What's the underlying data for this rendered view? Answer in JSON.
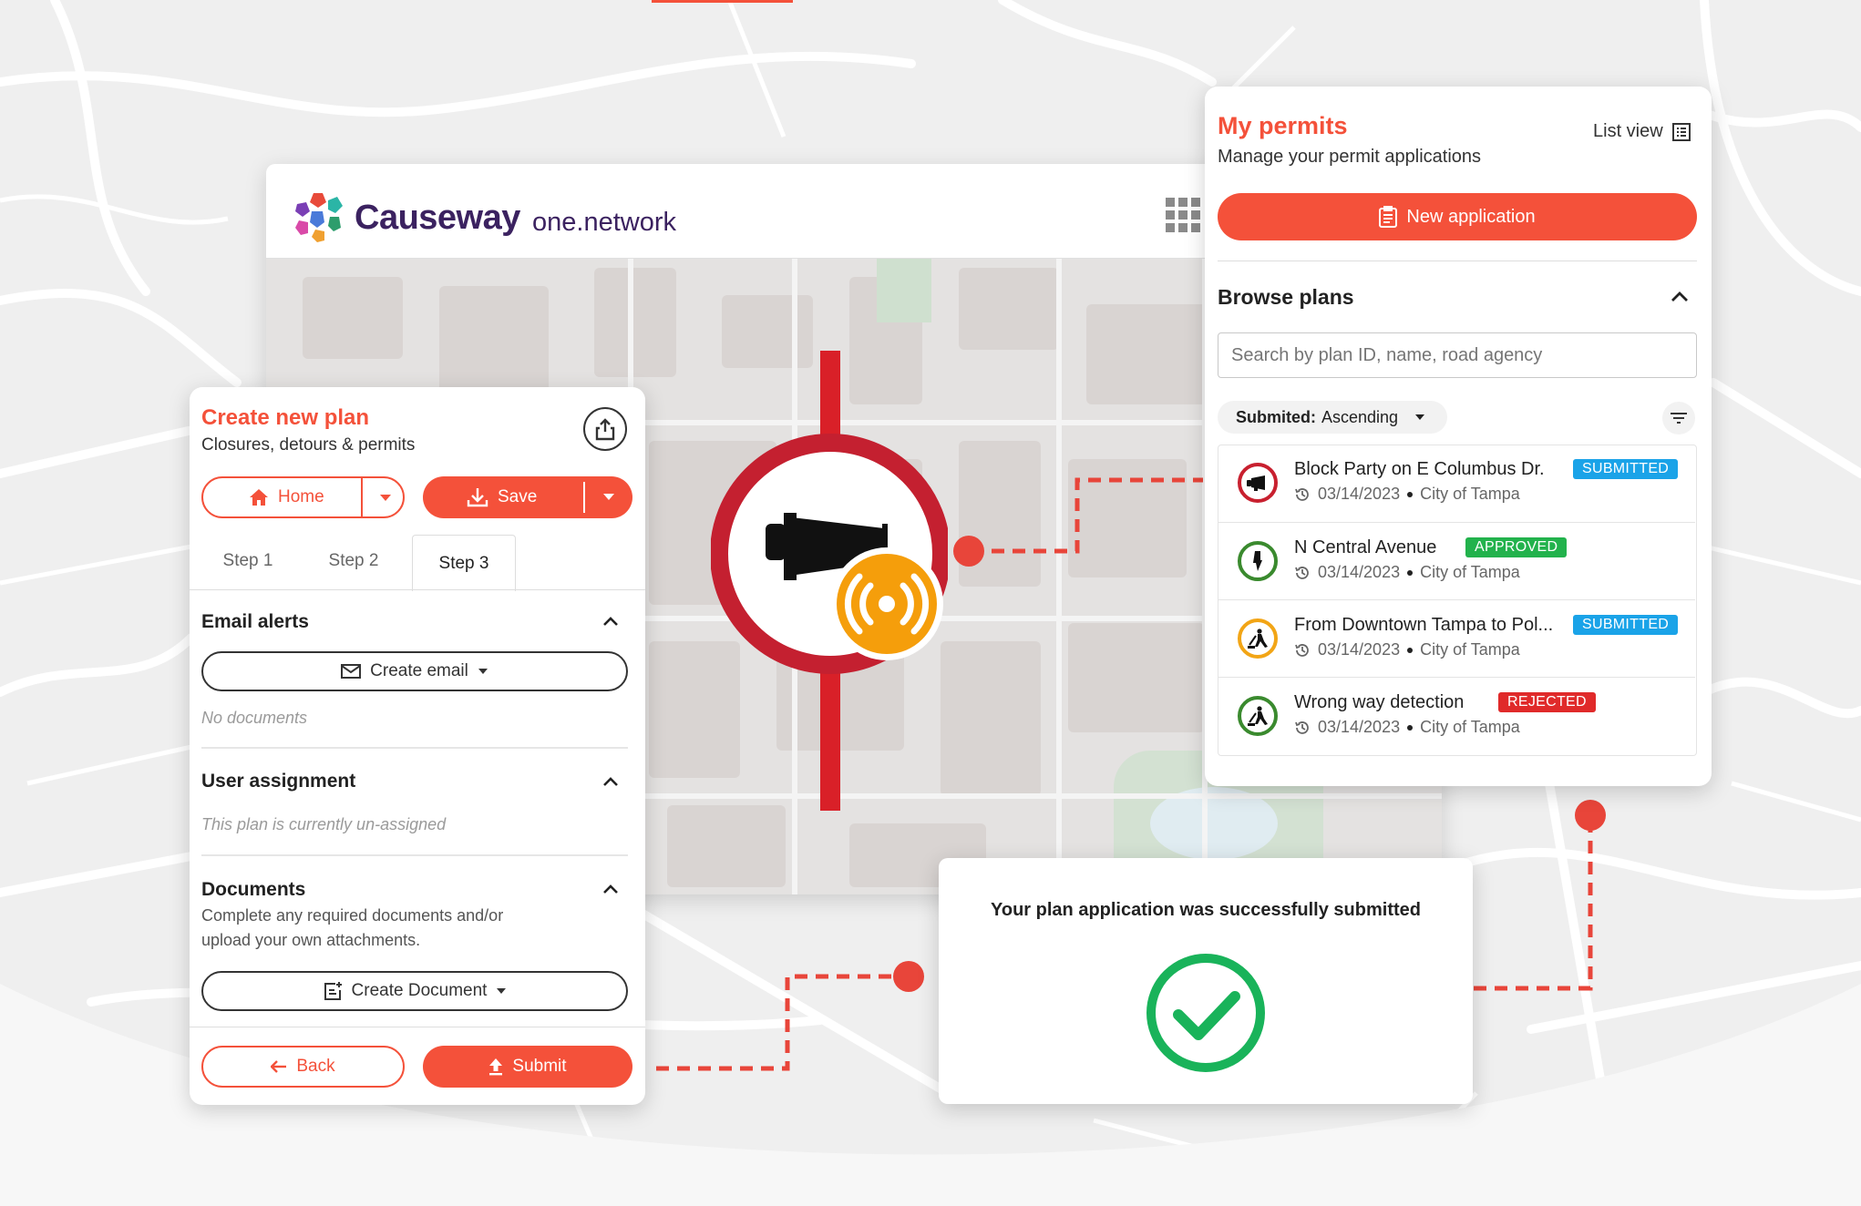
{
  "brand": {
    "name": "Causeway",
    "suffix": "one.network"
  },
  "create_plan": {
    "title": "Create new plan",
    "subtitle": "Closures, detours & permits",
    "home_label": "Home",
    "save_label": "Save",
    "steps": [
      "Step 1",
      "Step 2",
      "Step 3"
    ],
    "active_step": "Step 3",
    "email_alerts": {
      "title": "Email alerts",
      "button": "Create email",
      "empty": "No documents"
    },
    "user_assignment": {
      "title": "User assignment",
      "empty": "This plan is currently un-assigned"
    },
    "documents": {
      "title": "Documents",
      "description_line1": "Complete any required documents and/or",
      "description_line2": "upload your own attachments.",
      "button": "Create Document"
    },
    "back_label": "Back",
    "submit_label": "Submit"
  },
  "permits": {
    "title": "My permits",
    "subtitle": "Manage your permit applications",
    "list_view": "List view",
    "new_application": "New application",
    "browse_title": "Browse plans",
    "search_placeholder": "Search by plan ID, name, road agency",
    "sort_label": "Submited:",
    "sort_value": "Ascending",
    "items": [
      {
        "title": "Block Party on E Columbus Dr.",
        "status": "SUBMITTED",
        "date": "03/14/2023",
        "agency": "City of Tampa",
        "icon": "megaphone-icon",
        "ring": "#c8202f"
      },
      {
        "title": "N Central Avenue",
        "status": "APPROVED",
        "date": "03/14/2023",
        "agency": "City of Tampa",
        "icon": "traffic-light-icon",
        "ring": "#3a8a2e"
      },
      {
        "title": "From Downtown Tampa  to Pol...",
        "status": "SUBMITTED",
        "date": "03/14/2023",
        "agency": "City of Tampa",
        "icon": "roadworks-icon",
        "ring": "#f2a516"
      },
      {
        "title": "Wrong way detection",
        "status": "REJECTED",
        "date": "03/14/2023",
        "agency": "City of Tampa",
        "icon": "roadworks-icon",
        "ring": "#3a8a2e"
      }
    ]
  },
  "success": {
    "message": "Your plan application was successfully submitted"
  },
  "colors": {
    "accent": "#f4513a",
    "submitted": "#1aa3e8",
    "approved": "#22b24c",
    "rejected": "#e02a2a",
    "success": "#19b35a",
    "brand_text": "#3b2260"
  }
}
